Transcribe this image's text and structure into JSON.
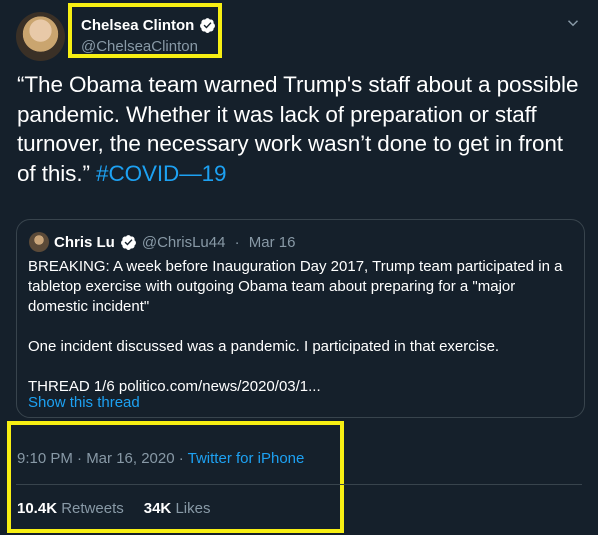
{
  "author": {
    "name": "Chelsea Clinton",
    "handle": "@ChelseaClinton"
  },
  "tweet": {
    "text": "“The Obama team warned Trump's staff about a possible pandemic. Whether it was lack of preparation or staff turnover, the necessary work wasn’t done to get in front of this.” ",
    "hashtag": "#COVID—19"
  },
  "quoted": {
    "name": "Chris Lu",
    "handle": "@ChrisLu44",
    "separator": " · ",
    "date": "Mar 16",
    "paragraphs": [
      "BREAKING: A week before Inauguration Day 2017, Trump team participated in a tabletop exercise with outgoing Obama team about preparing for a \"major domestic incident\"",
      "One incident discussed was a pandemic. I participated in that exercise.",
      "THREAD 1/6 politico.com/news/2020/03/1..."
    ],
    "show_thread": "Show this thread"
  },
  "meta": {
    "time": "9:10 PM · Mar 16, 2020 · ",
    "via": "Twitter for iPhone"
  },
  "stats": {
    "retweets_count": "10.4K",
    "retweets_label": "Retweets",
    "likes_count": "34K",
    "likes_label": "Likes"
  },
  "icons": {
    "verified": "verified-badge-icon",
    "caret": "chevron-down-icon"
  },
  "colors": {
    "background": "#15202b",
    "accent": "#1da1f2",
    "muted": "#8899a6",
    "highlight": "#f7ef13"
  }
}
